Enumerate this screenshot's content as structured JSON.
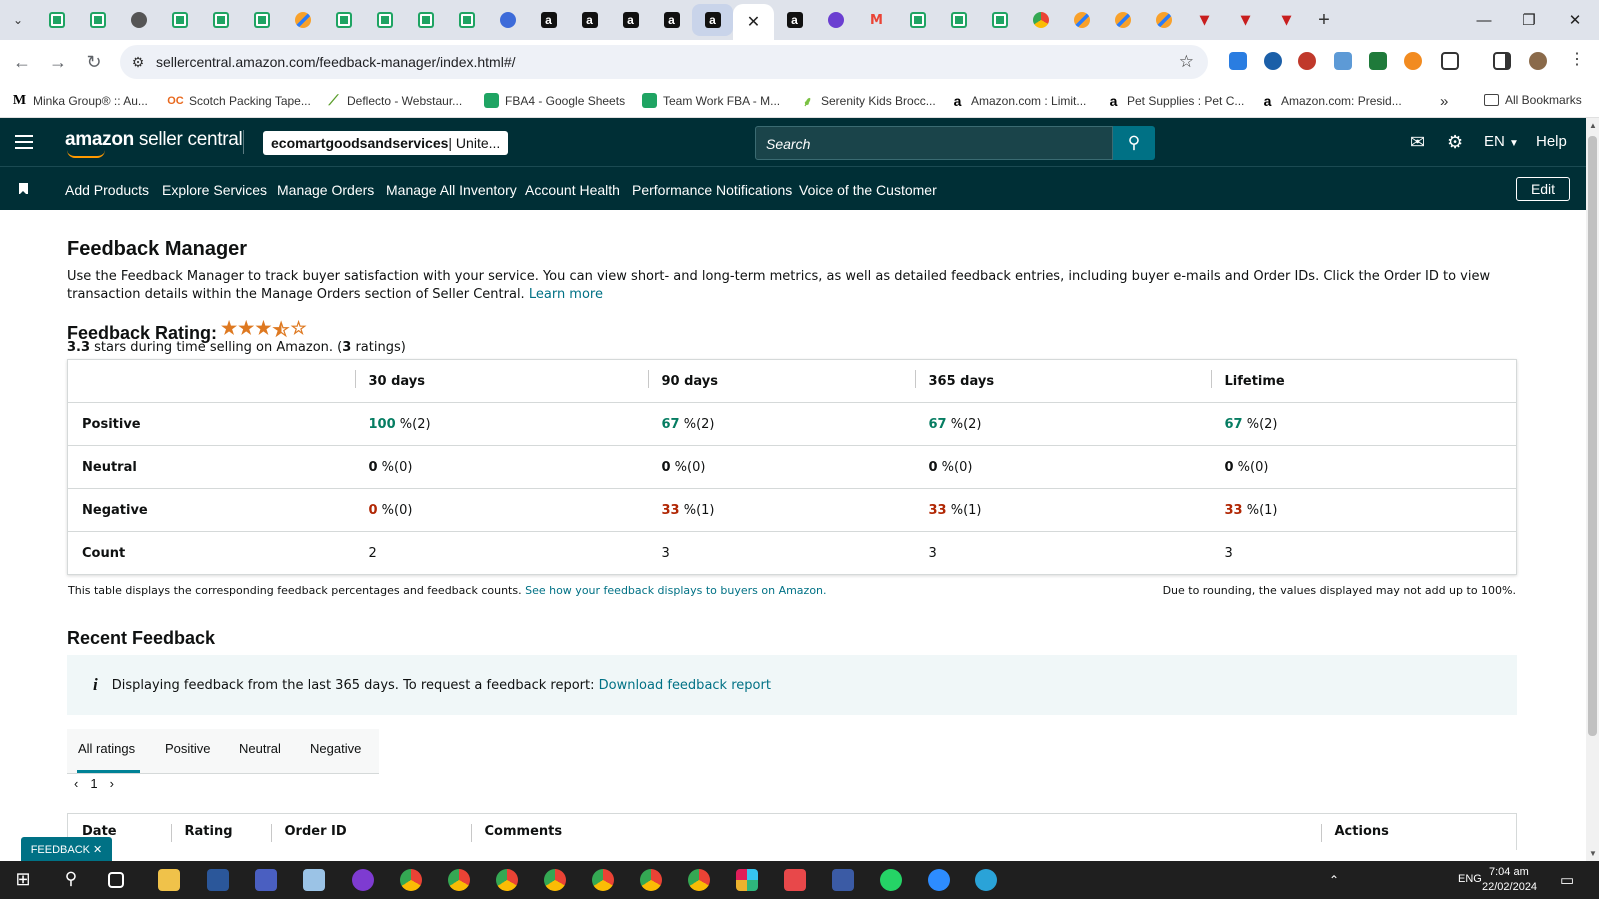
{
  "browser": {
    "url": "sellercentral.amazon.com/feedback-manager/index.html#/",
    "bookmarks": [
      {
        "label": "Minka Group® :: Au...",
        "icon": "minka-icon"
      },
      {
        "label": "Scotch Packing Tape...",
        "icon": "oc-icon"
      },
      {
        "label": "Deflecto - Webstaur...",
        "icon": "deflecto-icon"
      },
      {
        "label": "FBA4 - Google Sheets",
        "icon": "sheets-icon"
      },
      {
        "label": "Team Work FBA - M...",
        "icon": "sheets-icon"
      },
      {
        "label": "Serenity Kids Brocc...",
        "icon": "leaf-icon"
      },
      {
        "label": "Amazon.com : Limit...",
        "icon": "amazon-icon"
      },
      {
        "label": "Pet Supplies : Pet C...",
        "icon": "amazon-icon"
      },
      {
        "label": "Amazon.com: Presid...",
        "icon": "amazon-icon"
      }
    ],
    "bookmarks_more": "»",
    "all_bookmarks": "All Bookmarks"
  },
  "header": {
    "logo_text_bold": "amazon",
    "logo_text": " seller central",
    "account_name": "ecomartgoodsandservices",
    "account_region": " | Unite...",
    "search_placeholder": "Search",
    "language": "EN",
    "help": "Help"
  },
  "nav": {
    "items": [
      "Add Products",
      "Explore Services",
      "Manage Orders",
      "Manage All Inventory",
      "Account Health",
      "Performance Notifications",
      "Voice of the Customer"
    ],
    "edit": "Edit"
  },
  "page": {
    "title": "Feedback Manager",
    "intro": "Use the Feedback Manager to track buyer satisfaction with your service. You can view short- and long-term metrics, as well as detailed feedback entries, including buyer e-mails and Order IDs. Click the Order ID to view transaction details within the Manage Orders section of Seller Central.",
    "learn_more": "Learn more",
    "rating_label": "Feedback Rating:",
    "rating_value": 3.3,
    "rating_value_text": "3.3",
    "rating_text_1": " stars during time selling on Amazon. (",
    "rating_count": "3",
    "rating_text_2": " ratings)"
  },
  "metrics": {
    "columns": [
      "30 days",
      "90 days",
      "365 days",
      "Lifetime"
    ],
    "rows": [
      {
        "label": "Positive",
        "values": [
          [
            "100",
            " %(2)"
          ],
          [
            "67",
            " %(2)"
          ],
          [
            "67",
            " %(2)"
          ],
          [
            "67",
            " %(2)"
          ]
        ]
      },
      {
        "label": "Neutral",
        "values": [
          [
            "0",
            " %(0)"
          ],
          [
            "0",
            " %(0)"
          ],
          [
            "0",
            " %(0)"
          ],
          [
            "0",
            " %(0)"
          ]
        ]
      },
      {
        "label": "Negative",
        "values": [
          [
            "0",
            " %(0)"
          ],
          [
            "33",
            " %(1)"
          ],
          [
            "33",
            " %(1)"
          ],
          [
            "33",
            " %(1)"
          ]
        ]
      },
      {
        "label": "Count",
        "values": [
          [
            "2",
            ""
          ],
          [
            "3",
            ""
          ],
          [
            "3",
            ""
          ],
          [
            "3",
            ""
          ]
        ]
      }
    ],
    "note": "This table displays the corresponding feedback percentages and feedback counts.",
    "note_link": "See how your feedback displays to buyers on Amazon.",
    "rounding_note": "Due to rounding, the values displayed may not add up to 100%."
  },
  "recent": {
    "title": "Recent Feedback",
    "info": "Displaying feedback from the last 365 days. To request a feedback report:",
    "info_link": "Download feedback report",
    "tabs": [
      "All ratings",
      "Positive",
      "Neutral",
      "Negative"
    ],
    "page": "1",
    "columns": [
      "Date",
      "Rating",
      "Order ID",
      "Comments",
      "Actions"
    ]
  },
  "feedback_tab": "FEEDBACK ✕",
  "taskbar": {
    "time": "7:04 am",
    "date": "22/02/2024",
    "lang": "ENG"
  },
  "colors": {
    "header_bg": "#002f36",
    "accent": "#007185",
    "positive": "#067d62",
    "negative": "#b12704",
    "star": "#de7921"
  }
}
